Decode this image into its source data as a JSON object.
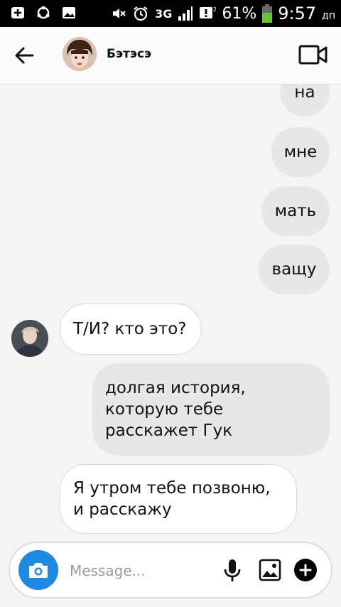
{
  "status_bar": {
    "signal_label": "3G",
    "battery": "61%",
    "time": "9:57",
    "ampm": "дп"
  },
  "header": {
    "title": "Бэтэсэ"
  },
  "messages": [
    {
      "text": "на",
      "direction": "outgoing"
    },
    {
      "text": "мне",
      "direction": "outgoing"
    },
    {
      "text": "мать",
      "direction": "outgoing"
    },
    {
      "text": "вaщу",
      "direction": "outgoing"
    },
    {
      "text": "Т/И? кто это?",
      "direction": "incoming"
    },
    {
      "text": "долгая история, которую тебе расскажет Гук",
      "direction": "outgoing"
    },
    {
      "text": "Я утром тебе позвоню, и расскажу",
      "direction": "incoming"
    }
  ],
  "composer": {
    "placeholder": "Message..."
  },
  "colors": {
    "outgoing_bubble": "#e7e7e9",
    "incoming_bubble": "#ffffff",
    "camera_button": "#1e88e5"
  },
  "icons": [
    "back-arrow-icon",
    "video-call-icon",
    "camera-icon",
    "microphone-icon",
    "gallery-icon",
    "plus-icon"
  ]
}
